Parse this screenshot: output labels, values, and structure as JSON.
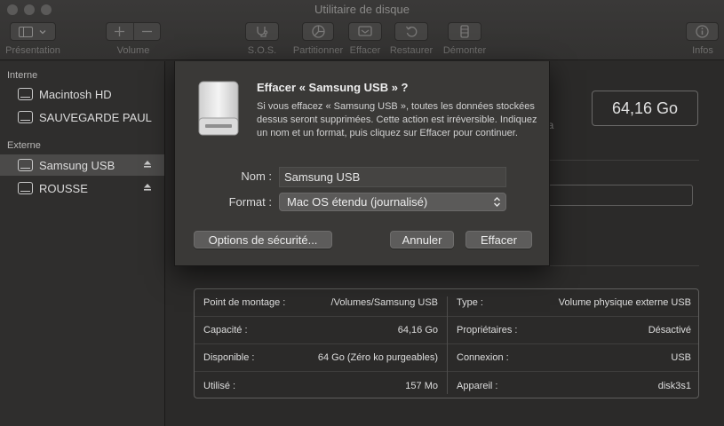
{
  "window": {
    "title": "Utilitaire de disque"
  },
  "toolbar": {
    "presentation_label": "Présentation",
    "volume_label": "Volume",
    "first_aid_label": "S.O.S.",
    "partition_label": "Partitionner",
    "erase_label": "Effacer",
    "restore_label": "Restaurer",
    "unmount_label": "Démonter",
    "info_label": "Infos"
  },
  "sidebar": {
    "internal_header": "Interne",
    "external_header": "Externe",
    "internal_items": [
      {
        "label": "Macintosh HD"
      },
      {
        "label": "SAUVEGARDE PAUL"
      }
    ],
    "external_items": [
      {
        "label": "Samsung USB",
        "selected": true
      },
      {
        "label": "ROUSSE",
        "selected": false
      }
    ]
  },
  "main": {
    "capacity": "64,16 Go",
    "partial_text": "na"
  },
  "info": {
    "left": [
      {
        "key": "Point de montage :",
        "value": "/Volumes/Samsung USB"
      },
      {
        "key": "Capacité :",
        "value": "64,16 Go"
      },
      {
        "key": "Disponible :",
        "value": "64 Go (Zéro ko purgeables)"
      },
      {
        "key": "Utilisé :",
        "value": "157 Mo"
      }
    ],
    "right": [
      {
        "key": "Type :",
        "value": "Volume physique externe USB"
      },
      {
        "key": "Propriétaires :",
        "value": "Désactivé"
      },
      {
        "key": "Connexion :",
        "value": "USB"
      },
      {
        "key": "Appareil :",
        "value": "disk3s1"
      }
    ]
  },
  "dialog": {
    "title": "Effacer « Samsung USB » ?",
    "message": "Si vous effacez « Samsung USB », toutes les données stockées dessus seront supprimées. Cette action est irréversible. Indiquez un nom et un format, puis cliquez sur Effacer pour continuer.",
    "name_label": "Nom :",
    "name_value": "Samsung USB",
    "format_label": "Format :",
    "format_value": "Mac OS étendu (journalisé)",
    "security_button": "Options de sécurité...",
    "cancel_button": "Annuler",
    "erase_button": "Effacer"
  }
}
